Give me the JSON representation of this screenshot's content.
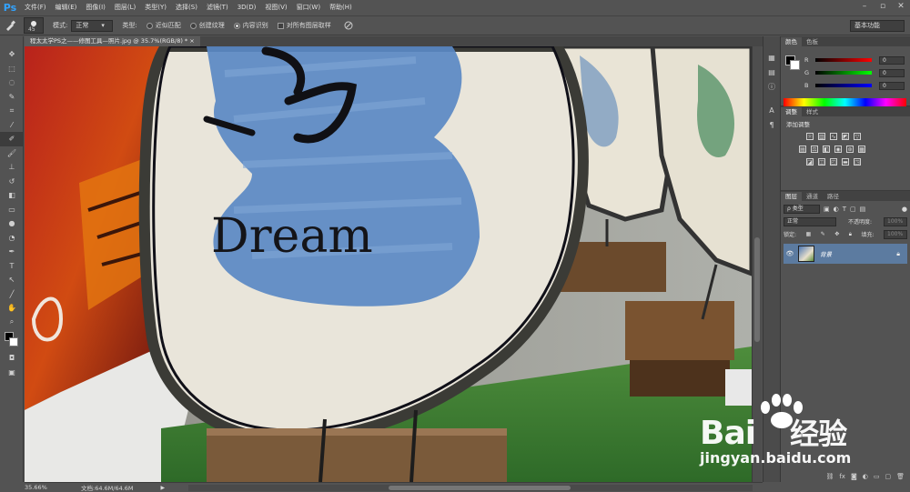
{
  "app": {
    "logo": "Ps"
  },
  "menu": [
    "文件(F)",
    "编辑(E)",
    "图像(I)",
    "图层(L)",
    "类型(Y)",
    "选择(S)",
    "滤镜(T)",
    "3D(D)",
    "视图(V)",
    "窗口(W)",
    "帮助(H)"
  ],
  "window_controls": [
    "–",
    "▫",
    "✕"
  ],
  "options": {
    "brush_size": "45",
    "mode_label": "模式:",
    "mode_value": "正常",
    "type_label": "类型:",
    "radio_1": "近似匹配",
    "radio_2": "创建纹理",
    "radio_3": "内容识别",
    "sample_all": "对所有图层取样",
    "workspace": "基本功能"
  },
  "document": {
    "tab_title": "程太太学PS之——修图工具—照片.jpg @ 35.7%(RGB/8) * ×",
    "canvas_text": "Dream",
    "zoom": "35.66%",
    "doc_size": "文档:64.6M/64.6M"
  },
  "color_panel": {
    "tabs": [
      "颜色",
      "色板"
    ],
    "r_label": "R",
    "g_label": "G",
    "b_label": "B",
    "r_value": "0",
    "g_value": "0",
    "b_value": "0"
  },
  "adjustments_panel": {
    "tabs": [
      "调整",
      "样式"
    ],
    "title": "添加调整"
  },
  "layers_panel": {
    "tabs": [
      "图层",
      "通道",
      "路径"
    ],
    "kind_filter": "ρ 类型",
    "blend_mode": "正常",
    "opacity_label": "不透明度:",
    "opacity_value": "100%",
    "lock_label": "锁定:",
    "fill_label": "填充:",
    "fill_value": "100%",
    "layer_name": "背景"
  },
  "watermark": {
    "logo_text": "Bai",
    "logo_text2": "经验",
    "url": "jingyan.baidu.com"
  },
  "colors": {
    "accent": "#33a3ff",
    "layer_selected": "#5c7ba0",
    "chrome": "#535353"
  }
}
